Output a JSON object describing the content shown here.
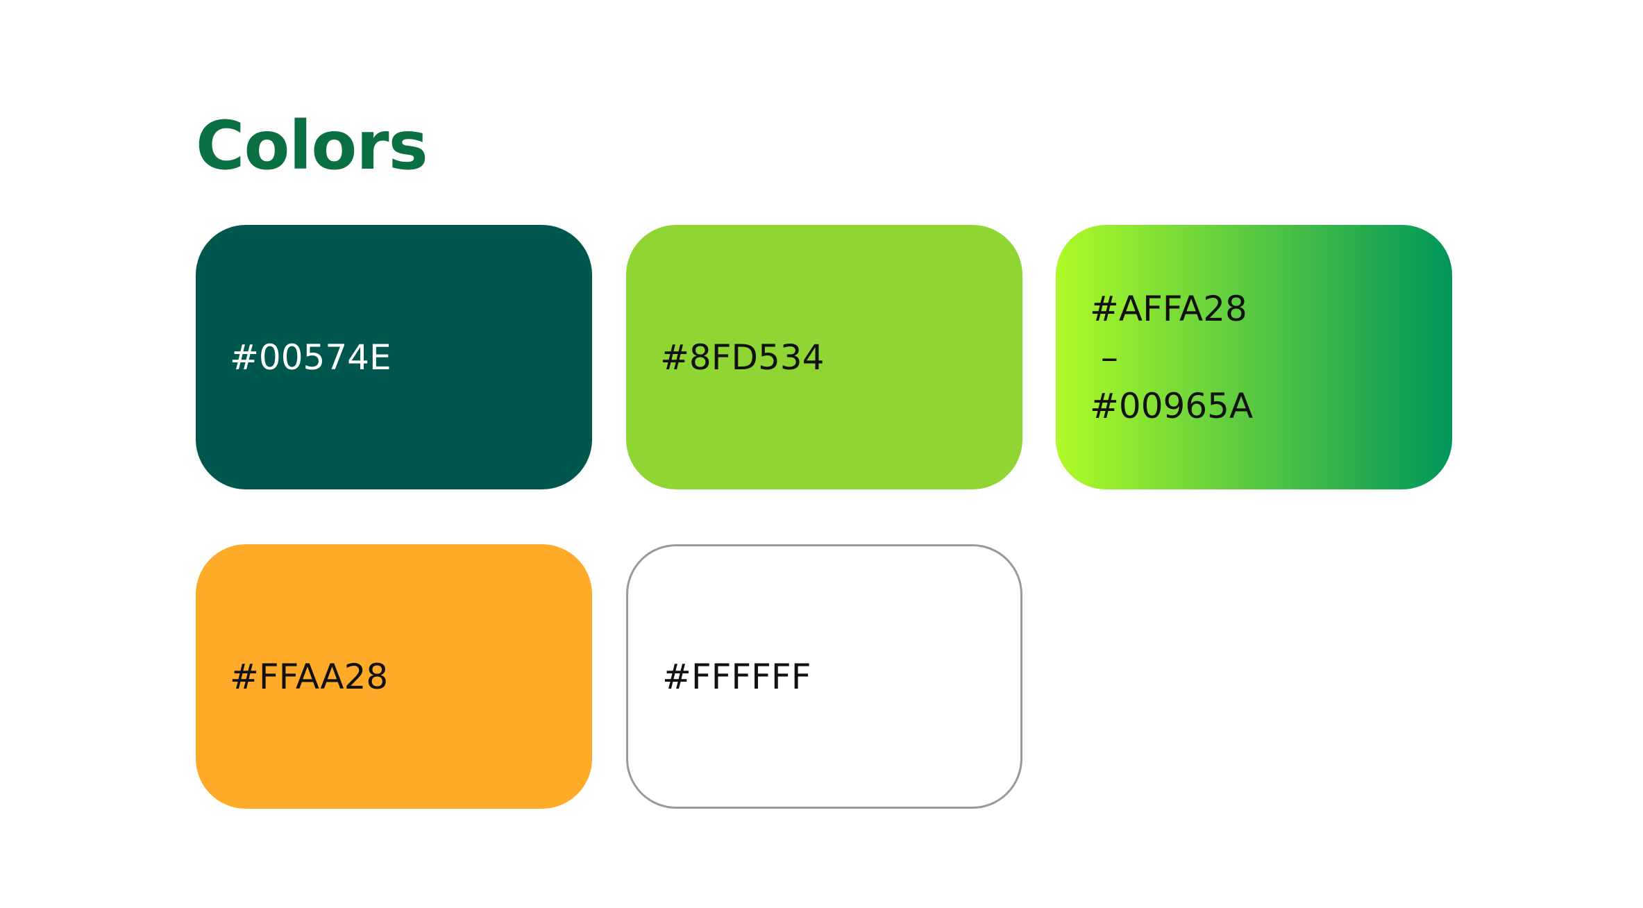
{
  "title": "Colors",
  "title_color": "#0a7042",
  "swatches": [
    {
      "label": "#00574E",
      "fill": "#00574E",
      "text_color": "#ffffff"
    },
    {
      "label": "#8FD534",
      "fill": "#8FD534",
      "text_color": "#111111"
    },
    {
      "label": "#AFFA28\n –\n#00965A",
      "fill_from": "#AFFA28",
      "fill_to": "#00965A",
      "text_color": "#111111"
    },
    {
      "label": "#FFAA28",
      "fill": "#FFAA28",
      "text_color": "#111111"
    },
    {
      "label": "#FFFFFF",
      "fill": "#FFFFFF",
      "text_color": "#111111",
      "border": "#999999"
    }
  ]
}
